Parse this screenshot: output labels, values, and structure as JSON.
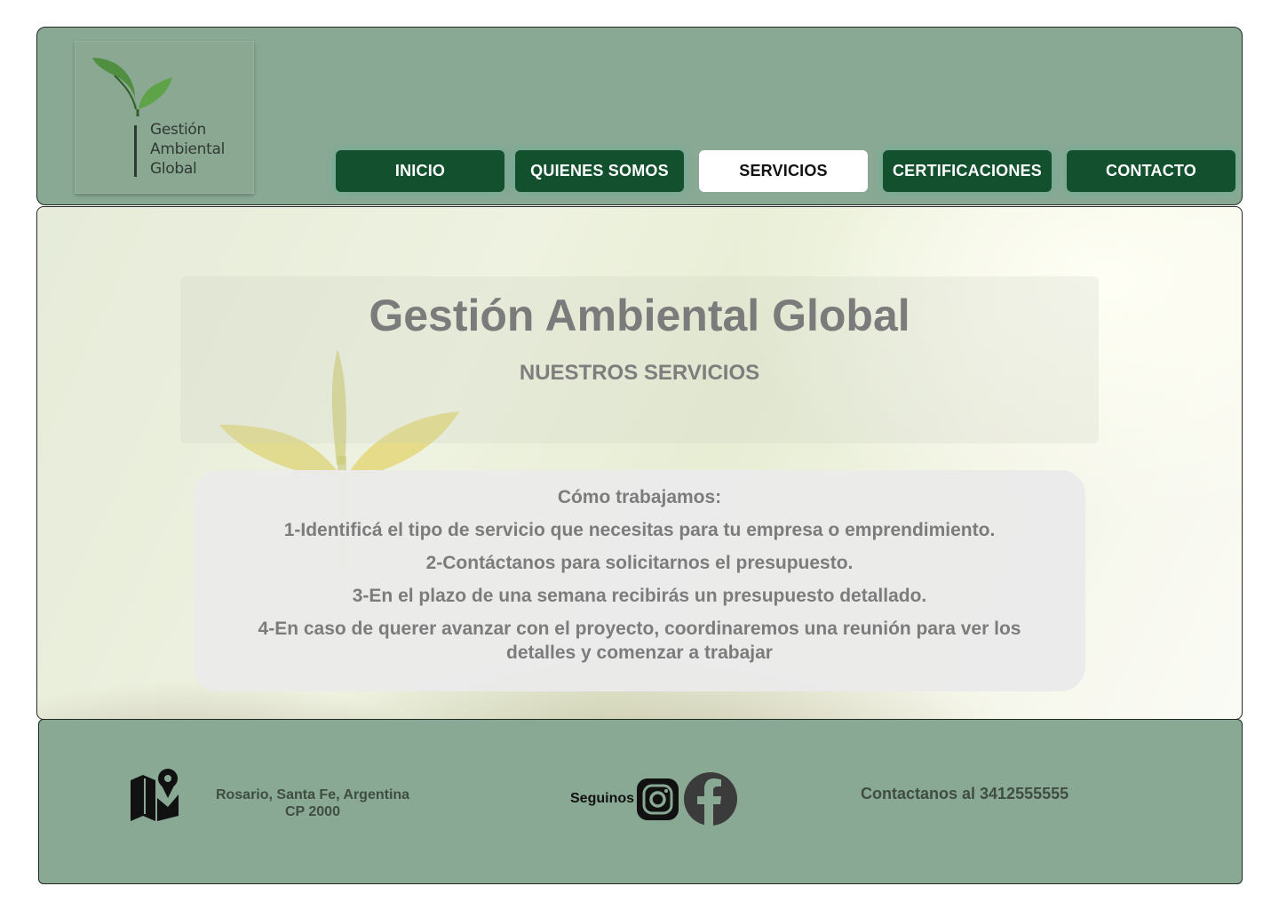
{
  "logo": {
    "lines": [
      "Gestión",
      "Ambiental",
      "Global"
    ],
    "icon": "sprout-logo"
  },
  "nav": {
    "items": [
      {
        "label": "INICIO",
        "active": false
      },
      {
        "label": "QUIENES SOMOS",
        "active": false
      },
      {
        "label": "SERVICIOS",
        "active": true
      },
      {
        "label": "CERTIFICACIONES",
        "active": false
      },
      {
        "label": "CONTACTO",
        "active": false
      }
    ]
  },
  "hero": {
    "title": "Gestión Ambiental Global",
    "subtitle": "NUESTROS SERVICIOS"
  },
  "steps": {
    "title": "Cómo trabajamos:",
    "items": [
      "1-Identificá el tipo de servicio que necesitas para tu empresa o emprendimiento.",
      "2-Contáctanos para solicitarnos el presupuesto.",
      "3-En el plazo de una semana recibirás un presupuesto detallado.",
      "4-En caso de querer avanzar con el proyecto, coordinaremos una reunión para ver los detalles y comenzar a trabajar"
    ]
  },
  "footer": {
    "address_line1": "Rosario, Santa Fe, Argentina",
    "address_line2": "CP 2000",
    "follow_label": "Seguinos",
    "contact": "Contactanos al 3412555555",
    "icons": [
      "map-pin-icon",
      "instagram-icon",
      "facebook-icon"
    ]
  },
  "colors": {
    "header_bg": "#89a995",
    "nav_bg": "#12502e",
    "nav_active_bg": "#ffffff",
    "footer_bg": "#89a995",
    "title_text": "#7b7b7b"
  }
}
